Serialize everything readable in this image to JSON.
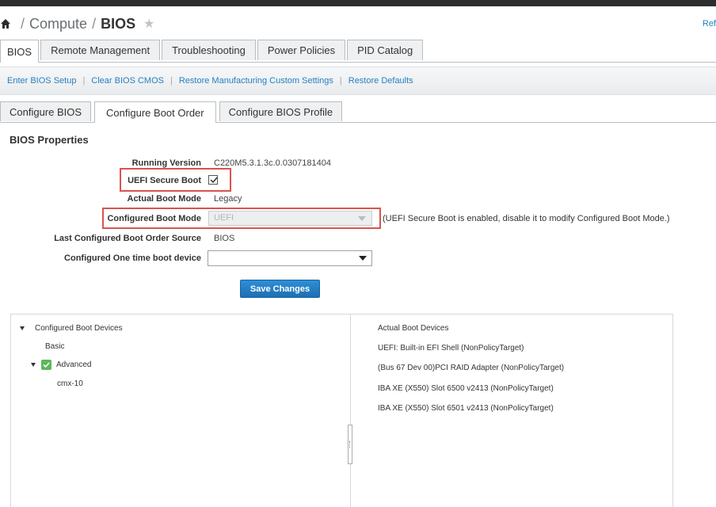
{
  "breadcrumb": {
    "items": [
      "Compute",
      "BIOS"
    ],
    "separator": "/"
  },
  "header": {
    "refresh_link": "Ref"
  },
  "main_tabs": [
    {
      "label": "BIOS",
      "active": true
    },
    {
      "label": "Remote Management",
      "active": false
    },
    {
      "label": "Troubleshooting",
      "active": false
    },
    {
      "label": "Power Policies",
      "active": false
    },
    {
      "label": "PID Catalog",
      "active": false
    }
  ],
  "actions": [
    "Enter BIOS Setup",
    "Clear BIOS CMOS",
    "Restore Manufacturing Custom Settings",
    "Restore Defaults"
  ],
  "action_separator": "|",
  "sub_tabs": [
    {
      "label": "Configure BIOS",
      "active": false
    },
    {
      "label": "Configure Boot Order",
      "active": true
    },
    {
      "label": "Configure BIOS Profile",
      "active": false
    }
  ],
  "bios_properties": {
    "title": "BIOS Properties",
    "running_version_label": "Running Version",
    "running_version": "C220M5.3.1.3c.0.0307181404",
    "uefi_secure_boot_label": "UEFI Secure Boot",
    "uefi_secure_boot_checked": true,
    "actual_boot_mode_label": "Actual Boot Mode",
    "actual_boot_mode": "Legacy",
    "configured_boot_mode_label": "Configured Boot Mode",
    "configured_boot_mode": "UEFI",
    "configured_boot_mode_hint": "(UEFI Secure Boot is enabled, disable it to modify Configured Boot Mode.)",
    "last_boot_order_source_label": "Last Configured Boot Order Source",
    "last_boot_order_source": "BIOS",
    "one_time_boot_label": "Configured One time boot device",
    "one_time_boot_value": ""
  },
  "save_button": "Save Changes",
  "configured_boot_devices": {
    "title": "Configured Boot Devices",
    "basic": "Basic",
    "advanced": "Advanced",
    "advanced_checked": true,
    "items": [
      "cmx-10"
    ]
  },
  "actual_boot_devices": {
    "title": "Actual Boot Devices",
    "items": [
      "UEFI: Built-in EFI Shell (NonPolicyTarget)",
      "(Bus 67 Dev 00)PCI RAID Adapter (NonPolicyTarget)",
      "IBA XE (X550) Slot 6500 v2413 (NonPolicyTarget)",
      "IBA XE (X550) Slot 6501 v2413 (NonPolicyTarget)"
    ]
  },
  "colors": {
    "accent_link": "#2a7fc0",
    "save_button": "#1d6fb3",
    "highlight_red": "#d9534f",
    "check_green": "#5cb85c"
  }
}
